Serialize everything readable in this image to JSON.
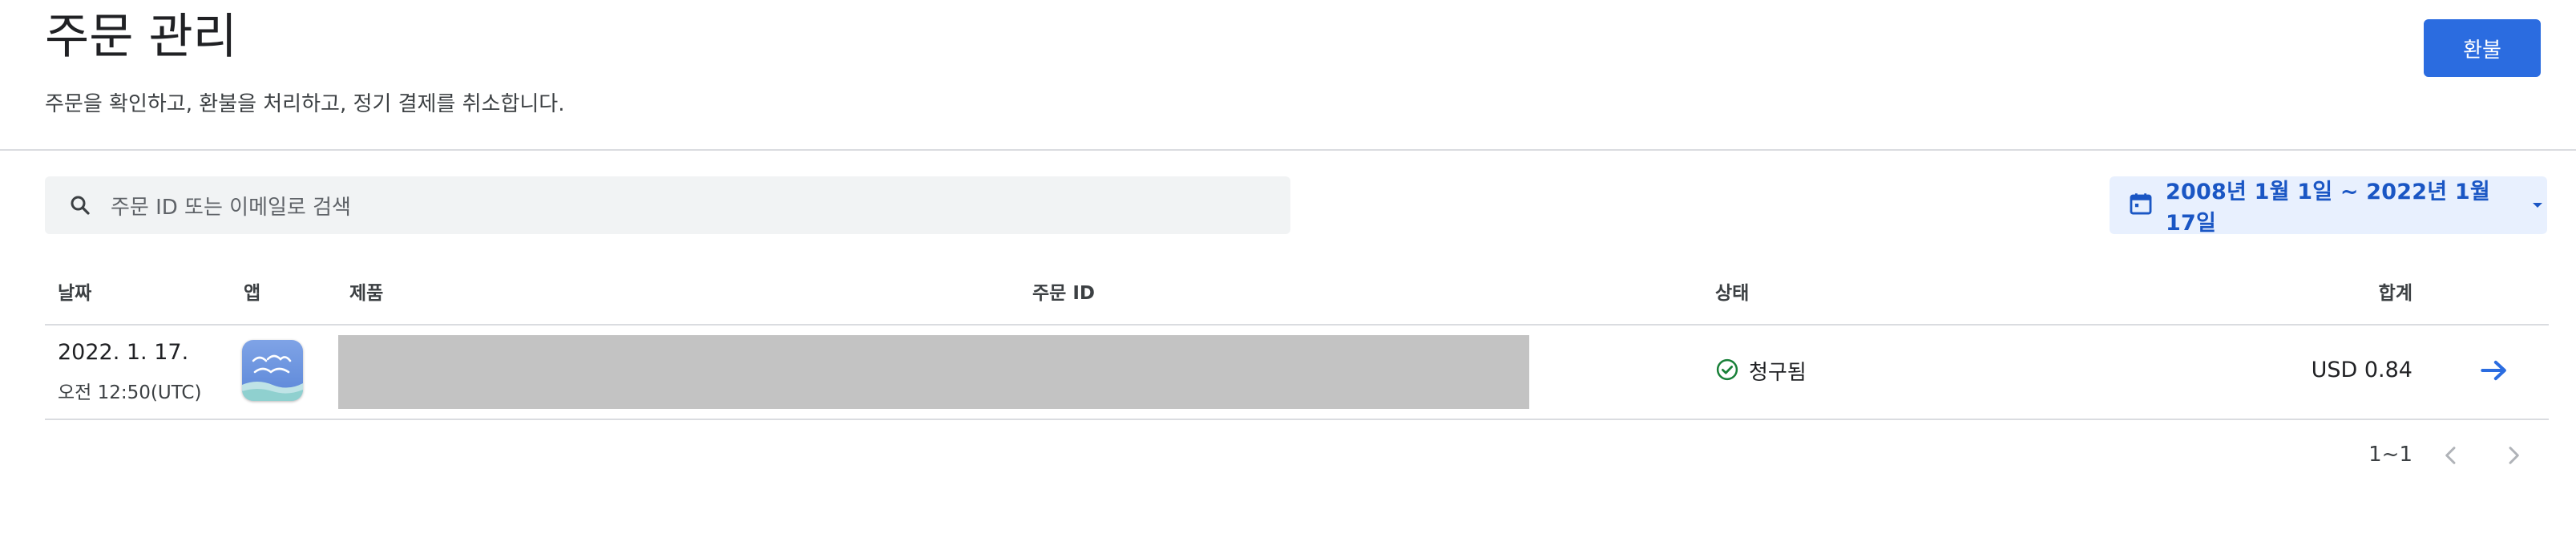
{
  "header": {
    "title": "주문 관리",
    "subtitle": "주문을 확인하고, 환불을 처리하고, 정기 결제를 취소합니다.",
    "refund_label": "환불"
  },
  "search": {
    "placeholder": "주문 ID 또는 이메일로 검색",
    "icon": "search-icon"
  },
  "date_range": {
    "label": "2008년 1월 1일 ~ 2022년 1월 17일",
    "icon": "calendar-icon"
  },
  "table": {
    "columns": [
      "날짜",
      "앱",
      "제품",
      "주문 ID",
      "상태",
      "합계"
    ],
    "rows": [
      {
        "date": "2022. 1. 17.",
        "time": "오전 12:50(UTC)",
        "status": "청구됨",
        "total": "USD 0.84"
      }
    ]
  },
  "pagination": {
    "range": "1~1"
  },
  "colors": {
    "accent": "#2b6ce0",
    "date_bg": "#e8f0fe",
    "status_ok": "#188038",
    "redaction": "#c3c3c3"
  }
}
